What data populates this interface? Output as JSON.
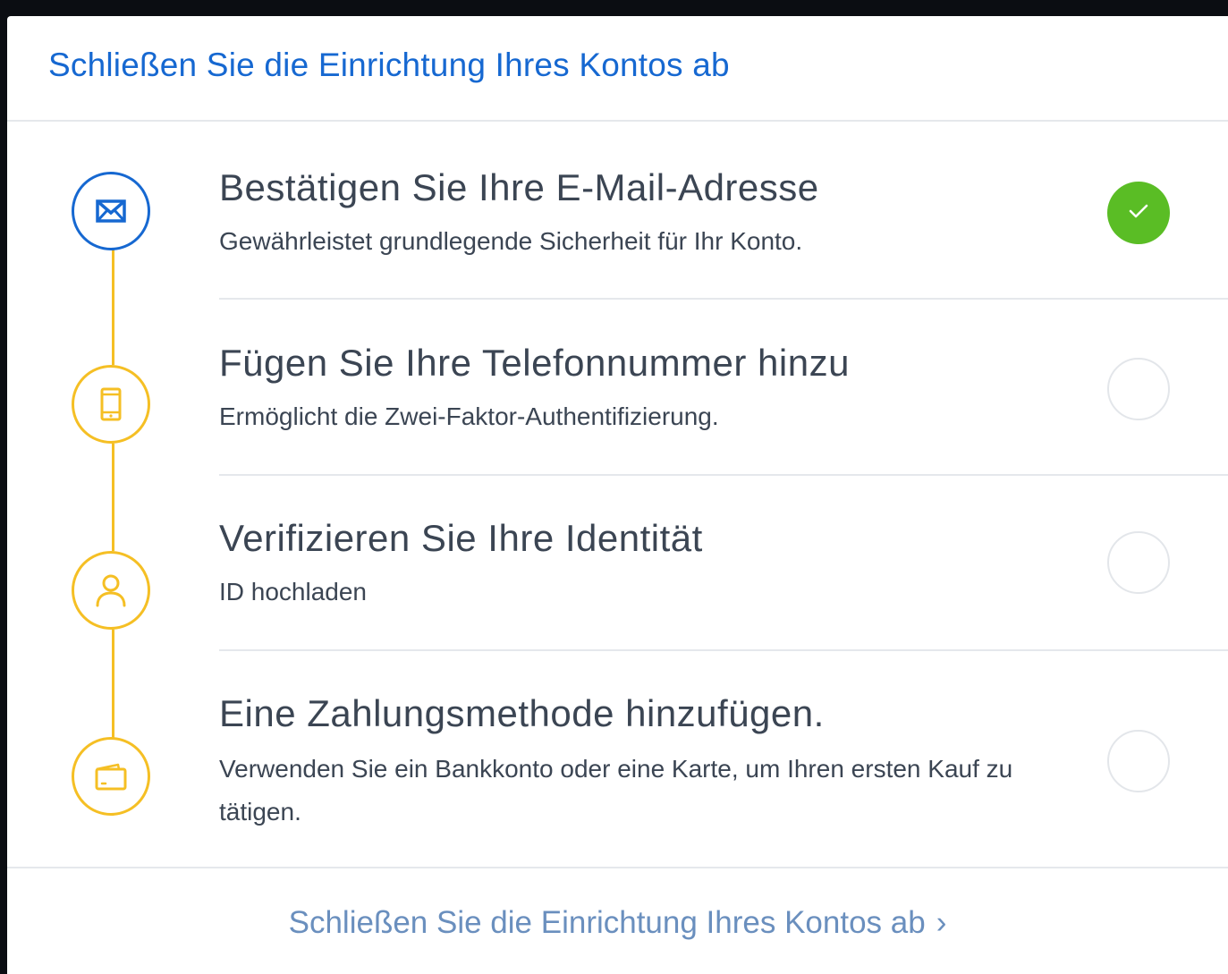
{
  "header": {
    "title": "Schließen Sie die Einrichtung Ihres Kontos ab"
  },
  "steps": [
    {
      "title": "Bestätigen Sie Ihre E-Mail-Adresse",
      "description": "Gewährleistet grundlegende Sicherheit für Ihr Konto.",
      "icon": "envelope-icon",
      "completed": true
    },
    {
      "title": "Fügen Sie Ihre Telefonnummer hinzu",
      "description": "Ermöglicht die Zwei-Faktor-Authentifizierung.",
      "icon": "phone-icon",
      "completed": false
    },
    {
      "title": "Verifizieren Sie Ihre Identität",
      "description": "ID hochladen",
      "icon": "user-icon",
      "completed": false
    },
    {
      "title": "Eine Zahlungsmethode hinzufügen.",
      "description": "Verwenden Sie ein Bankkonto oder eine Karte, um Ihren ersten Kauf zu tätigen.",
      "icon": "wallet-icon",
      "completed": false
    }
  ],
  "footer": {
    "link_label": "Schließen Sie die Einrichtung Ihres Kontos ab",
    "chevron": "›"
  },
  "colors": {
    "accent_blue": "#1668d1",
    "step_yellow": "#f5bf24",
    "done_green": "#5abd25",
    "text_dark": "#3b4553",
    "link_muted": "#6a8fbe"
  }
}
